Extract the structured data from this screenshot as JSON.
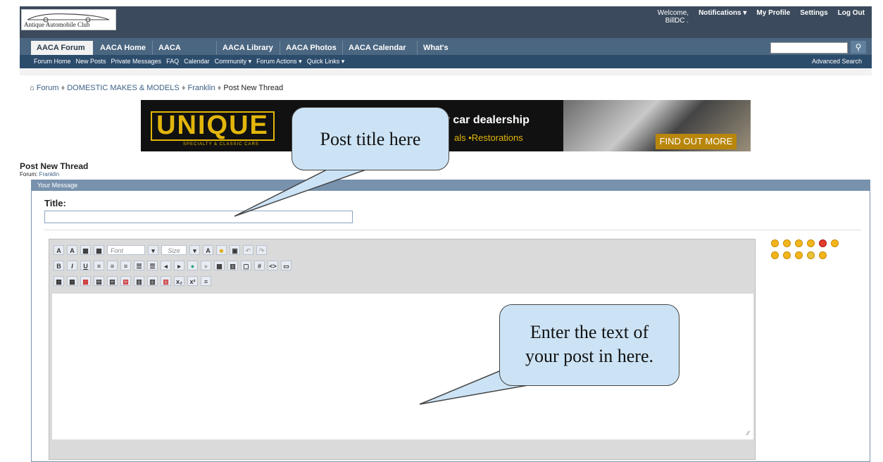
{
  "header": {
    "logo_text": "Antique Automobile Club",
    "welcome": "Welcome,",
    "username": "BillDC .",
    "notifications": "Notifications ▾",
    "my_profile": "My Profile",
    "settings": "Settings",
    "logout": "Log Out"
  },
  "tabs": [
    "AACA Forum",
    "AACA Home",
    "AACA Museum",
    "AACA Library",
    "AACA Photos",
    "AACA Calendar",
    "What's New?"
  ],
  "search_icon": "search-icon",
  "subnav": {
    "links": [
      "Forum Home",
      "New Posts",
      "Private Messages",
      "FAQ",
      "Calendar",
      "Community ▾",
      "Forum Actions ▾",
      "Quick Links ▾"
    ],
    "advanced_search": "Advanced Search"
  },
  "breadcrumb": [
    "Forum",
    "DOMESTIC MAKES & MODELS",
    "Franklin",
    "Post New Thread"
  ],
  "banner": {
    "brand": "UNIQUE",
    "brand_sub": "SPECIALTY & CLASSIC CARS",
    "tagline": "y car dealership",
    "tagline2": "als  •Restorations",
    "cta": "FIND OUT MORE"
  },
  "page": {
    "title": "Post New Thread",
    "forum_label": "Forum:",
    "forum_name": "Franklin",
    "panel_title": "Your Message",
    "title_label": "Title:"
  },
  "editor": {
    "font_placeholder": "Font",
    "size_placeholder": "Size",
    "row2": [
      "B",
      "I",
      "U",
      "≡",
      "≡",
      "≡",
      "☰",
      "☰",
      "◂",
      "▸",
      "●",
      "●",
      "▦",
      "▥",
      "▢",
      "#",
      "<>",
      "▭"
    ]
  },
  "callouts": {
    "title_hint": "Post title here",
    "body_hint_line1": "Enter the text of",
    "body_hint_line2": "your post in here."
  },
  "colors": {
    "header_bg": "#3b4a5c",
    "tab_bar": "#4b6680",
    "subnav": "#2c4c6c",
    "callout": "#cce3f5"
  }
}
